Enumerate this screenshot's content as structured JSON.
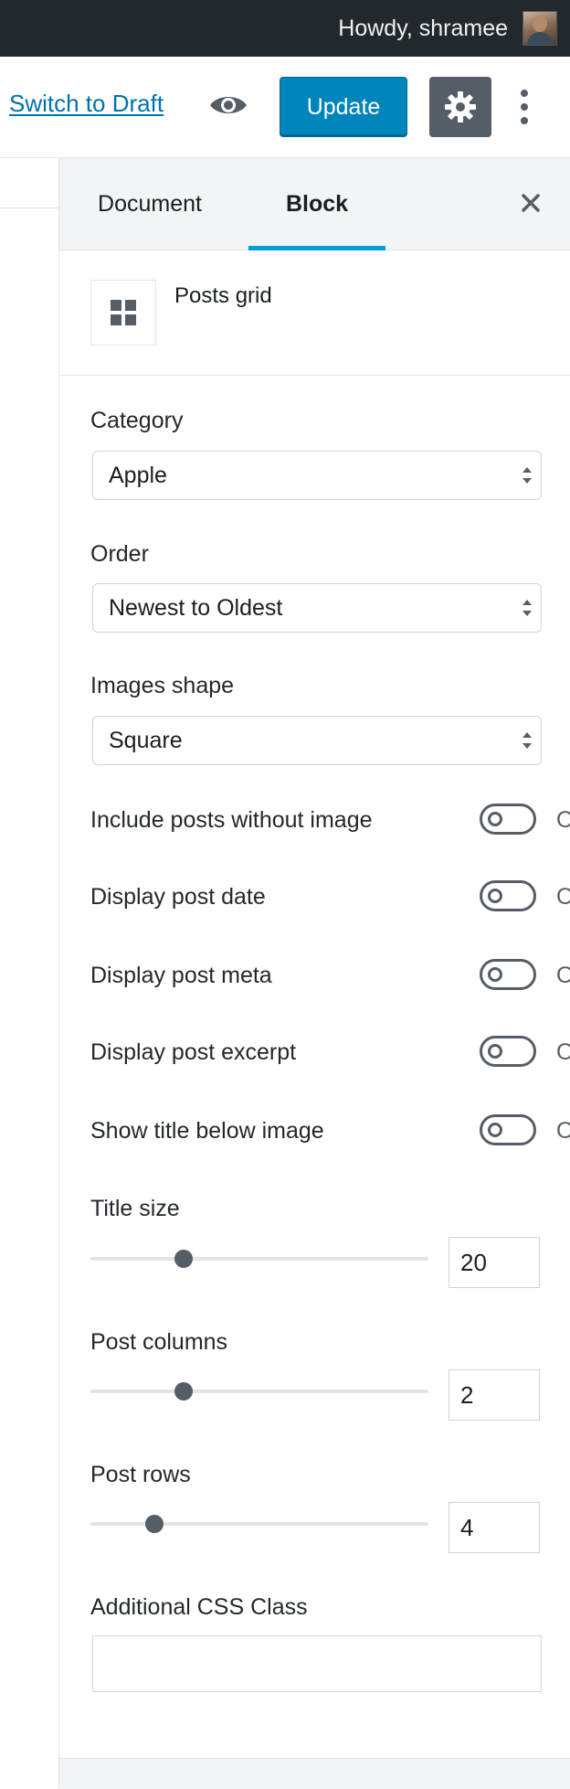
{
  "admin_bar": {
    "greeting": "Howdy, shramee"
  },
  "toolbar": {
    "switch_to_draft": "Switch to Draft",
    "update_label": "Update",
    "preview_icon": "eye-icon",
    "settings_icon": "gear-icon",
    "more_icon": "vertical-ellipsis-icon"
  },
  "sidebar": {
    "tabs": [
      {
        "label": "Document",
        "active": false
      },
      {
        "label": "Block",
        "active": true
      }
    ],
    "close_icon": "close-icon",
    "block": {
      "icon": "grid-icon",
      "name": "Posts grid"
    },
    "selects": [
      {
        "label": "Category",
        "value": "Apple"
      },
      {
        "label": "Order",
        "value": "Newest to Oldest"
      },
      {
        "label": "Images shape",
        "value": "Square"
      }
    ],
    "toggles": [
      {
        "label": "Include posts without image",
        "state": "Off"
      },
      {
        "label": "Display post date",
        "state": "Off"
      },
      {
        "label": "Display post meta",
        "state": "Off"
      },
      {
        "label": "Display post excerpt",
        "state": "Off"
      },
      {
        "label": "Show title below image",
        "state": "Off"
      }
    ],
    "ranges": [
      {
        "label": "Title size",
        "value": "20"
      },
      {
        "label": "Post columns",
        "value": "2"
      },
      {
        "label": "Post rows",
        "value": "4"
      }
    ],
    "css_class": {
      "label": "Additional CSS Class",
      "value": ""
    }
  },
  "colors": {
    "accent": "#0085ba",
    "tab_indicator": "#00a0d2",
    "admin_bar": "#23282d",
    "link": "#0073aa"
  }
}
